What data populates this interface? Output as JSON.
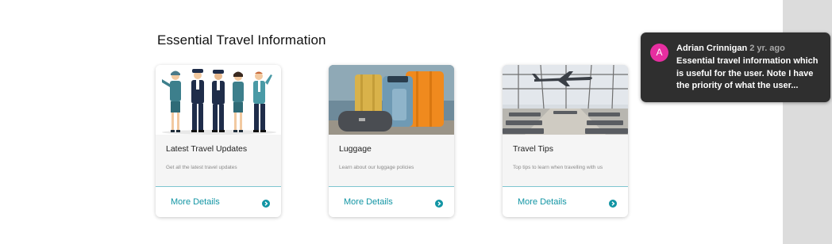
{
  "section": {
    "title": "Essential Travel Information"
  },
  "cards": [
    {
      "title": "Latest Travel Updates",
      "description": "Get all the latest travel updates",
      "link": "More Details",
      "image": "airline-crew-illustration"
    },
    {
      "title": "Luggage",
      "description": "Learn about our luggage policies",
      "link": "More Details",
      "image": "suitcases-photo"
    },
    {
      "title": "Travel Tips",
      "description": "Top tips to learn when travelling with us",
      "link": "More Details",
      "image": "airport-terminal-photo"
    }
  ],
  "comment": {
    "avatar_initial": "A",
    "author": "Adrian Crinnigan",
    "time": "2 yr. ago",
    "text": "Essential travel information which is useful for the user. Note I have the priority of what the user..."
  },
  "colors": {
    "accent": "#1295a4",
    "avatar": "#e62ea0",
    "comment_bg": "#2f2f2f",
    "side_panel": "#dcdcdc"
  }
}
